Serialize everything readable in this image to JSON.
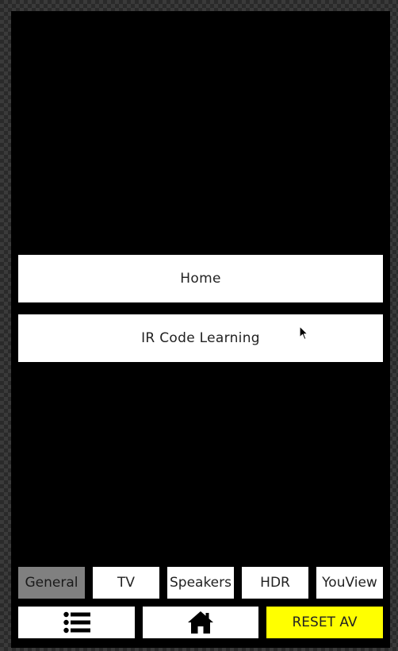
{
  "menu": {
    "home_label": "Home",
    "ir_label": "IR Code Learning"
  },
  "tabs": [
    {
      "label": "General",
      "active": true
    },
    {
      "label": "TV",
      "active": false
    },
    {
      "label": "Speakers",
      "active": false
    },
    {
      "label": "HDR",
      "active": false
    },
    {
      "label": "YouView",
      "active": false
    }
  ],
  "bottom_bar": {
    "list_icon": "list-icon",
    "home_icon": "house-icon",
    "reset_label": "RESET AV"
  },
  "colors": {
    "background": "#000000",
    "button": "#ffffff",
    "active_tab": "#808080",
    "reset_button": "#ffff00"
  }
}
